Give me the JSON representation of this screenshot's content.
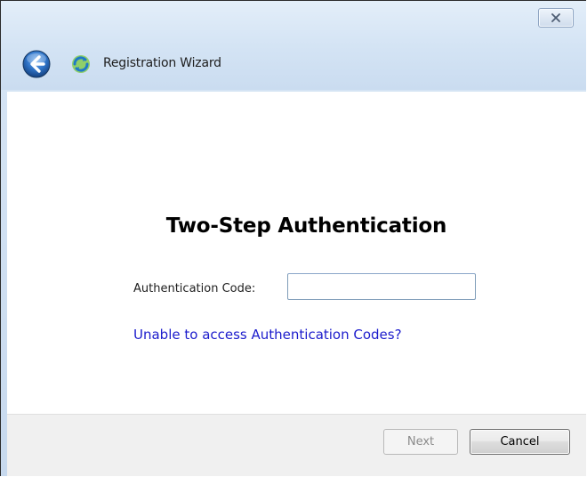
{
  "window": {
    "title": "Registration Wizard"
  },
  "icons": {
    "close": "close-icon",
    "back": "back-arrow-icon",
    "app": "registration-wizard-icon"
  },
  "main": {
    "heading": "Two-Step Authentication",
    "code_label": "Authentication Code:",
    "code_value": "",
    "help_link": "Unable to access Authentication Codes?"
  },
  "footer": {
    "next_label": "Next",
    "cancel_label": "Cancel",
    "next_enabled": false
  },
  "colors": {
    "link": "#1c1ccc",
    "titlebar": "#d3e3f4",
    "footer": "#f0f0f0"
  }
}
